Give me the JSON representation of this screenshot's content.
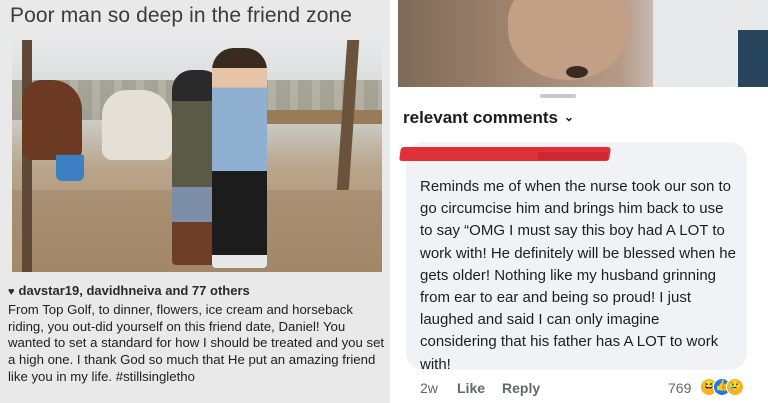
{
  "left_post": {
    "title": "Poor man so deep in the friend zone",
    "likes_text": "davstar19, davidhneiva and 77 others",
    "caption": "From Top Golf, to dinner, flowers, ice cream and horseback riding, you out-did yourself on this friend date, Daniel! You wanted to set a standard for how I should be treated and you set a high one. I thank God so much that He put an amazing friend like you in my life. #stillsingletho",
    "heart_icon": "♥"
  },
  "right_post": {
    "section_title": "relevant comments",
    "chevron_icon": "⌄",
    "comment_text": "Reminds me of when the nurse took our son to go circumcise him and brings him back to use to say “OMG I must say this boy had A LOT to work with! He definitely will be blessed when he gets older! Nothing like my husband grinning from ear to ear and being so proud! I just laughed and said I can only imagine considering that his father has A LOT to work with!",
    "time": "2w",
    "like_label": "Like",
    "reply_label": "Reply",
    "reaction_count": "769",
    "reactions": [
      "haha",
      "like",
      "sad"
    ]
  },
  "colors": {
    "left_background": "#e9e9e9",
    "bubble_background": "#f0f2f5",
    "redaction": "#e0313a",
    "meta_text": "#65676b",
    "like_blue": "#1877f2"
  }
}
